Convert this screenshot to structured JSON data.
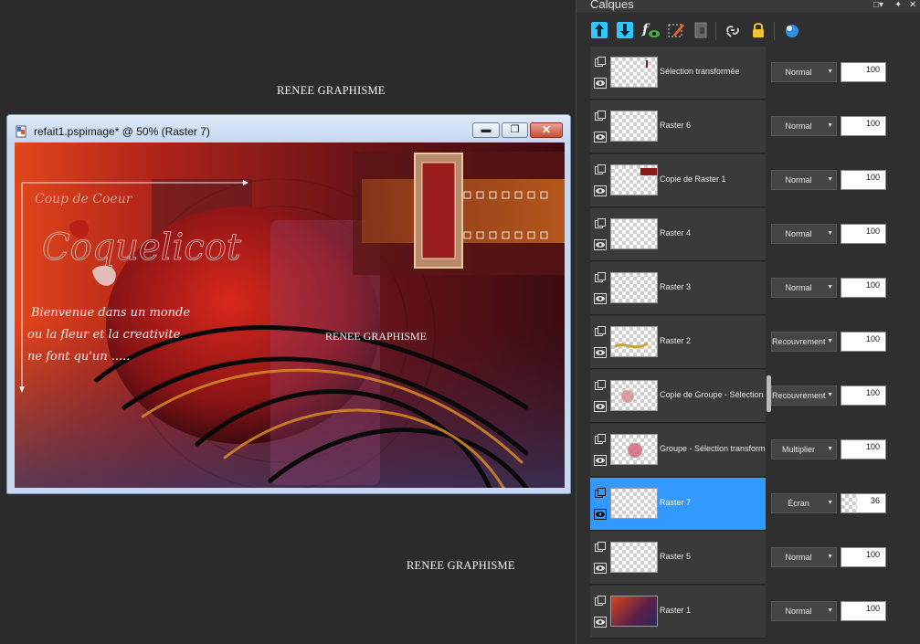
{
  "watermarks": [
    "RENEE GRAPHISME",
    "RENEE GRAPHISME",
    "RENEE GRAPHISME"
  ],
  "document": {
    "title": "refait1.pspimage* @  50% (Raster 7)",
    "canvas_text": {
      "signature_small": "Coup de Coeur",
      "signature_large": "Coquelicot",
      "line1": "Bienvenue dans un monde",
      "line2": "ou la fleur et la creativite",
      "line3": "ne font qu'un   .....",
      "watermark": "RENEE GRAPHISME"
    }
  },
  "layers_panel": {
    "title": "Calques",
    "toolbar_icons": [
      "move-layer-up-icon",
      "move-layer-down-icon",
      "layer-effects-icon",
      "edit-selection-icon",
      "layer-properties-icon",
      "link-layers-icon",
      "lock-transparency-icon",
      "mask-icon"
    ],
    "layers": [
      {
        "name": "Sélection transformée",
        "blend": "Normal",
        "opacity": 100,
        "selected": false
      },
      {
        "name": "Raster 6",
        "blend": "Normal",
        "opacity": 100,
        "selected": false
      },
      {
        "name": "Copie de Raster 1",
        "blend": "Normal",
        "opacity": 100,
        "selected": false
      },
      {
        "name": "Raster 4",
        "blend": "Normal",
        "opacity": 100,
        "selected": false
      },
      {
        "name": "Raster 3",
        "blend": "Normal",
        "opacity": 100,
        "selected": false
      },
      {
        "name": "Raster 2",
        "blend": "Recouvrement",
        "opacity": 100,
        "selected": false
      },
      {
        "name": "Copie de Groupe - Sélection t",
        "blend": "Recouvrement",
        "opacity": 100,
        "selected": false
      },
      {
        "name": "Groupe - Sélection transforme",
        "blend": "Multiplier",
        "opacity": 100,
        "selected": false
      },
      {
        "name": "Raster 7",
        "blend": "Écran",
        "opacity": 36,
        "selected": true
      },
      {
        "name": "Raster 5",
        "blend": "Normal",
        "opacity": 100,
        "selected": false
      },
      {
        "name": "Raster 1",
        "blend": "Normal",
        "opacity": 100,
        "selected": false
      }
    ]
  },
  "colors": {
    "selected_layer": "#3399ff",
    "panel_bg": "#2f2f2f",
    "workspace_bg": "#2b2b2b"
  }
}
